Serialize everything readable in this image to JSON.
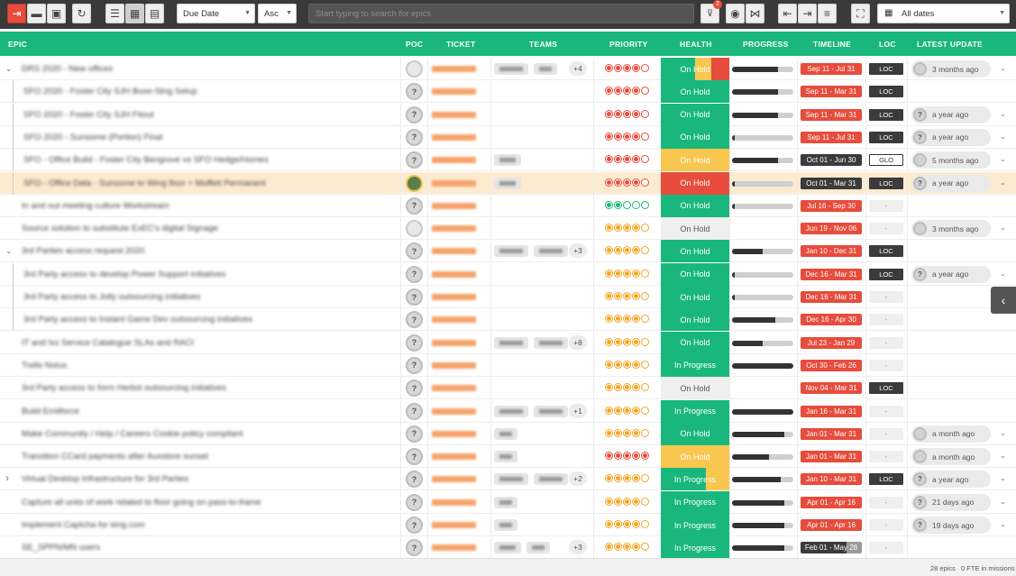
{
  "toolbar": {
    "sort_field": "Due Date",
    "sort_order": "Asc",
    "search_placeholder": "Start typing to search for epics",
    "filter_count": "2",
    "date_range": "All dates"
  },
  "headers": {
    "epic": "EPIC",
    "poc": "POC",
    "ticket": "TICKET",
    "teams": "TEAMS",
    "priority": "PRIORITY",
    "health": "HEALTH",
    "progress": "PROGRESS",
    "timeline": "TIMELINE",
    "loc": "LOC",
    "latest_update": "LATEST UPDATE"
  },
  "colors": {
    "green": "#1ab77c",
    "red": "#e74c3c",
    "orange": "#f5a623",
    "yellow": "#f9c74f",
    "dark": "#3b3b3b",
    "light": "#efefef"
  },
  "rows": [
    {
      "expander": "down",
      "level": 0,
      "name": "DRS 2020 - New offices",
      "bold": false,
      "avatar": "blank",
      "teams": [
        38,
        26
      ],
      "plus": "+4",
      "prio_color": "red",
      "prio": 4,
      "health": "On Hold",
      "health_bg": "split-yor",
      "progress": 0.75,
      "timeline": "Sep 11 - Jul 31",
      "tl_color": "red",
      "loc": "LOC",
      "loc_style": "dark",
      "update": "3 months ago",
      "update_avatar": "blank"
    },
    {
      "expander": "",
      "level": 1,
      "name": "SFO 2020 - Foster City SJH Boxe-Stng Setup",
      "avatar": "q",
      "teams": [],
      "prio_color": "red",
      "prio": 4,
      "health": "On Hold",
      "health_bg": "green",
      "progress": 0.75,
      "timeline": "Sep 11 - Mar 31",
      "tl_color": "red",
      "loc": "LOC",
      "loc_style": "dark"
    },
    {
      "expander": "",
      "level": 1,
      "name": "SFO 2020 - Foster City SJH Fitout",
      "avatar": "q",
      "teams": [],
      "prio_color": "red",
      "prio": 4,
      "health": "On Hold",
      "health_bg": "green",
      "progress": 0.75,
      "timeline": "Sep 11 - Mar 31",
      "tl_color": "red",
      "loc": "LOC",
      "loc_style": "dark",
      "update": "a year ago",
      "update_avatar": "q"
    },
    {
      "expander": "",
      "level": 1,
      "name": "SFO 2020 - Sunsome (Portion) Final",
      "avatar": "q",
      "teams": [],
      "prio_color": "red",
      "prio": 4,
      "health": "On Hold",
      "health_bg": "green",
      "progress": 0.05,
      "timeline": "Sep 11 - Jul 31",
      "tl_color": "red",
      "loc": "LOC",
      "loc_style": "dark",
      "update": "a year ago",
      "update_avatar": "q"
    },
    {
      "expander": "",
      "level": 1,
      "name": "SFO - Office Build - Foster City Bengrove vs SFO Hedge/Homes",
      "avatar": "q",
      "teams": [
        30
      ],
      "prio_color": "red",
      "prio": 4,
      "health": "On Hold",
      "health_bg": "yellow",
      "progress": 0.75,
      "timeline": "Oct 01 - Jun 30",
      "tl_color": "dark",
      "loc": "GLO",
      "loc_style": "outline",
      "update": "5 months ago",
      "update_avatar": "blank"
    },
    {
      "expander": "",
      "level": 1,
      "name": "SFO - Office Data - Sunsome to Wing floor + Moffett Permanent",
      "avatar": "photo",
      "teams": [
        30
      ],
      "prio_color": "red",
      "prio": 4,
      "health": "On Hold",
      "health_bg": "red",
      "progress": 0.05,
      "timeline": "Oct 01 - Mar 31",
      "tl_color": "dark",
      "loc": "LOC",
      "loc_style": "dark",
      "update": "a year ago",
      "update_avatar": "q",
      "selected": true
    },
    {
      "expander": "",
      "level": 0,
      "name": "In and out meeting culture Workstream",
      "avatar": "q",
      "teams": [],
      "prio_color": "green",
      "prio": 2,
      "health": "On Hold",
      "health_bg": "green",
      "progress": 0.0,
      "timeline": "Jul 16 - Sep 30",
      "tl_color": "red",
      "loc": "-",
      "loc_style": "dash"
    },
    {
      "expander": "",
      "level": 0,
      "name": "Source solution to substitute ExEC's digital Signage",
      "avatar": "blank",
      "teams": [],
      "prio_color": "orange",
      "prio": 4,
      "health": "On Hold",
      "health_bg": "light",
      "progress": null,
      "timeline": "Jun 19 - Nov 06",
      "tl_color": "red",
      "loc": "-",
      "loc_style": "dash",
      "update": "3 months ago",
      "update_avatar": "blank"
    },
    {
      "expander": "down",
      "level": 0,
      "name": "3rd Parties access request 2020",
      "avatar": "q",
      "teams": [
        38,
        38
      ],
      "plus": "+3",
      "prio_color": "orange",
      "prio": 4,
      "health": "On Hold",
      "health_bg": "green",
      "progress": 0.5,
      "timeline": "Jan 10 - Dec 31",
      "tl_color": "red",
      "loc": "LOC",
      "loc_style": "dark"
    },
    {
      "expander": "",
      "level": 1,
      "name": "3rd Party access to develop Power Support initiatives",
      "avatar": "q",
      "teams": [],
      "prio_color": "orange",
      "prio": 4,
      "health": "On Hold",
      "health_bg": "green",
      "progress": 0.05,
      "timeline": "Dec 16 - Mar 31",
      "tl_color": "red",
      "loc": "LOC",
      "loc_style": "dark",
      "update": "a year ago",
      "update_avatar": "q"
    },
    {
      "expander": "",
      "level": 1,
      "name": "3rd Party access to Jolly outsourcing initiatives",
      "avatar": "q",
      "teams": [],
      "prio_color": "orange",
      "prio": 4,
      "health": "On Hold",
      "health_bg": "green",
      "progress": 0.05,
      "timeline": "Dec 16 - Mar 31",
      "tl_color": "red",
      "loc": "-",
      "loc_style": "dash"
    },
    {
      "expander": "",
      "level": 1,
      "name": "3rd Party access to Instant Game Dev outsourcing initiatives",
      "avatar": "q",
      "teams": [],
      "prio_color": "orange",
      "prio": 4,
      "health": "On Hold",
      "health_bg": "green",
      "progress": 0.7,
      "timeline": "Dec 16 - Apr 30",
      "tl_color": "red",
      "loc": "-",
      "loc_style": "dash"
    },
    {
      "expander": "",
      "level": 0,
      "name": "IT and Ixx Service Catalogue SLAs and RACI",
      "avatar": "q",
      "teams": [
        38,
        38
      ],
      "plus": "+8",
      "prio_color": "orange",
      "prio": 4,
      "health": "On Hold",
      "health_bg": "green",
      "progress": 0.5,
      "timeline": "Jul 23 - Jan 29",
      "tl_color": "red",
      "loc": "-",
      "loc_style": "dash"
    },
    {
      "expander": "",
      "level": 0,
      "name": "Trello Nstus",
      "avatar": "q",
      "teams": [],
      "prio_color": "orange",
      "prio": 4,
      "health": "In Progress",
      "health_bg": "green",
      "progress": 1.0,
      "timeline": "Oct 30 - Feb 26",
      "tl_color": "red",
      "loc": "-",
      "loc_style": "dash"
    },
    {
      "expander": "",
      "level": 0,
      "name": "3rd Party access to form Herbst outsourcing initiatives",
      "avatar": "q",
      "teams": [],
      "prio_color": "orange",
      "prio": 4,
      "health": "On Hold",
      "health_bg": "light",
      "progress": null,
      "timeline": "Nov 04 - Mar 31",
      "tl_color": "red",
      "loc": "LOC",
      "loc_style": "dark"
    },
    {
      "expander": "",
      "level": 0,
      "name": "Build Emitforce",
      "avatar": "q",
      "teams": [
        38,
        38
      ],
      "plus": "+1",
      "prio_color": "orange",
      "prio": 4,
      "health": "In Progress",
      "health_bg": "green",
      "progress": 1.0,
      "timeline": "Jan 16 - Mar 31",
      "tl_color": "red",
      "loc": "-",
      "loc_style": "dash"
    },
    {
      "expander": "",
      "level": 0,
      "name": "Make Community / Help / Careers Cookie policy compliant",
      "avatar": "q",
      "teams": [
        26
      ],
      "prio_color": "orange",
      "prio": 4,
      "health": "On Hold",
      "health_bg": "green",
      "progress": 0.85,
      "timeline": "Jan 01 - Mar 31",
      "tl_color": "red",
      "loc": "-",
      "loc_style": "dash",
      "update": "a month ago",
      "update_avatar": "blank"
    },
    {
      "expander": "",
      "level": 0,
      "name": "Transition CCard payments after Auxstore sunset",
      "avatar": "q",
      "teams": [
        26
      ],
      "prio_color": "red",
      "prio": 5,
      "health": "On Hold",
      "health_bg": "yellow",
      "progress": 0.6,
      "timeline": "Jan 01 - Mar 31",
      "tl_color": "red",
      "loc": "-",
      "loc_style": "dash",
      "update": "a month ago",
      "update_avatar": "blank"
    },
    {
      "expander": "right",
      "level": 0,
      "name": "Virtual Desktop Infrastructure for 3rd Parties",
      "avatar": "q",
      "teams": [
        38,
        38
      ],
      "plus": "+2",
      "prio_color": "orange",
      "prio": 4,
      "health": "In Progress",
      "health_bg": "split-gy",
      "progress": 0.8,
      "timeline": "Jan 10 - Mar 31",
      "tl_color": "red",
      "loc": "LOC",
      "loc_style": "dark",
      "update": "a year ago",
      "update_avatar": "q"
    },
    {
      "expander": "",
      "level": 0,
      "name": "Capture all units of work related to floor going on pass-to-frame",
      "avatar": "q",
      "teams": [
        26
      ],
      "prio_color": "orange",
      "prio": 4,
      "health": "In Progress",
      "health_bg": "green",
      "progress": 0.85,
      "timeline": "Apr 01 - Apr 16",
      "tl_color": "red",
      "loc": "-",
      "loc_style": "dash",
      "update": "21 days ago",
      "update_avatar": "q"
    },
    {
      "expander": "",
      "level": 0,
      "name": "Implement Captcha for king.com",
      "avatar": "q",
      "teams": [
        26
      ],
      "prio_color": "orange",
      "prio": 4,
      "health": "In Progress",
      "health_bg": "green",
      "progress": 0.85,
      "timeline": "Apr 01 - Apr 16",
      "tl_color": "red",
      "loc": "-",
      "loc_style": "dash",
      "update": "19 days ago",
      "update_avatar": "q"
    },
    {
      "expander": "",
      "level": 0,
      "name": "SE_SPPN/MN users",
      "avatar": "q",
      "teams": [
        30,
        26
      ],
      "plus": "+3",
      "prio_color": "orange",
      "prio": 4,
      "health": "In Progress",
      "health_bg": "green",
      "progress": 0.85,
      "timeline": "Feb 01 - May 28",
      "tl_color": "darkgrey",
      "loc": "-",
      "loc_style": "dash"
    }
  ],
  "footer": {
    "epic_count": "28 epics",
    "fte": "0 FTE in missions"
  }
}
